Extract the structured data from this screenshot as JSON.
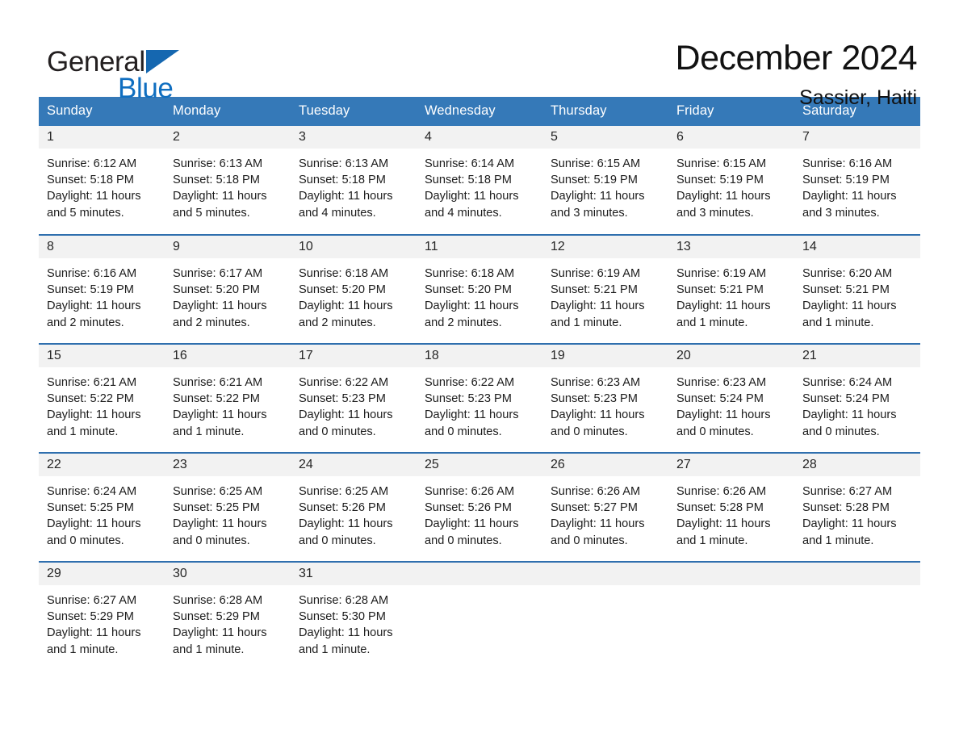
{
  "brand": {
    "word1": "General",
    "word2": "Blue",
    "flag_color": "#1567b0",
    "blue_text_color": "#0f6ec0"
  },
  "header": {
    "title": "December 2024",
    "location": "Sassier, Haiti"
  },
  "theme": {
    "header_bg": "#3579b8",
    "row_divider": "#2f6fae",
    "daynum_bg": "#f2f2f2",
    "page_bg": "#ffffff"
  },
  "calendar": {
    "weekday_headers": [
      "Sunday",
      "Monday",
      "Tuesday",
      "Wednesday",
      "Thursday",
      "Friday",
      "Saturday"
    ],
    "weeks": [
      [
        {
          "day": "1",
          "sunrise": "Sunrise: 6:12 AM",
          "sunset": "Sunset: 5:18 PM",
          "daylight1": "Daylight: 11 hours",
          "daylight2": "and 5 minutes."
        },
        {
          "day": "2",
          "sunrise": "Sunrise: 6:13 AM",
          "sunset": "Sunset: 5:18 PM",
          "daylight1": "Daylight: 11 hours",
          "daylight2": "and 5 minutes."
        },
        {
          "day": "3",
          "sunrise": "Sunrise: 6:13 AM",
          "sunset": "Sunset: 5:18 PM",
          "daylight1": "Daylight: 11 hours",
          "daylight2": "and 4 minutes."
        },
        {
          "day": "4",
          "sunrise": "Sunrise: 6:14 AM",
          "sunset": "Sunset: 5:18 PM",
          "daylight1": "Daylight: 11 hours",
          "daylight2": "and 4 minutes."
        },
        {
          "day": "5",
          "sunrise": "Sunrise: 6:15 AM",
          "sunset": "Sunset: 5:19 PM",
          "daylight1": "Daylight: 11 hours",
          "daylight2": "and 3 minutes."
        },
        {
          "day": "6",
          "sunrise": "Sunrise: 6:15 AM",
          "sunset": "Sunset: 5:19 PM",
          "daylight1": "Daylight: 11 hours",
          "daylight2": "and 3 minutes."
        },
        {
          "day": "7",
          "sunrise": "Sunrise: 6:16 AM",
          "sunset": "Sunset: 5:19 PM",
          "daylight1": "Daylight: 11 hours",
          "daylight2": "and 3 minutes."
        }
      ],
      [
        {
          "day": "8",
          "sunrise": "Sunrise: 6:16 AM",
          "sunset": "Sunset: 5:19 PM",
          "daylight1": "Daylight: 11 hours",
          "daylight2": "and 2 minutes."
        },
        {
          "day": "9",
          "sunrise": "Sunrise: 6:17 AM",
          "sunset": "Sunset: 5:20 PM",
          "daylight1": "Daylight: 11 hours",
          "daylight2": "and 2 minutes."
        },
        {
          "day": "10",
          "sunrise": "Sunrise: 6:18 AM",
          "sunset": "Sunset: 5:20 PM",
          "daylight1": "Daylight: 11 hours",
          "daylight2": "and 2 minutes."
        },
        {
          "day": "11",
          "sunrise": "Sunrise: 6:18 AM",
          "sunset": "Sunset: 5:20 PM",
          "daylight1": "Daylight: 11 hours",
          "daylight2": "and 2 minutes."
        },
        {
          "day": "12",
          "sunrise": "Sunrise: 6:19 AM",
          "sunset": "Sunset: 5:21 PM",
          "daylight1": "Daylight: 11 hours",
          "daylight2": "and 1 minute."
        },
        {
          "day": "13",
          "sunrise": "Sunrise: 6:19 AM",
          "sunset": "Sunset: 5:21 PM",
          "daylight1": "Daylight: 11 hours",
          "daylight2": "and 1 minute."
        },
        {
          "day": "14",
          "sunrise": "Sunrise: 6:20 AM",
          "sunset": "Sunset: 5:21 PM",
          "daylight1": "Daylight: 11 hours",
          "daylight2": "and 1 minute."
        }
      ],
      [
        {
          "day": "15",
          "sunrise": "Sunrise: 6:21 AM",
          "sunset": "Sunset: 5:22 PM",
          "daylight1": "Daylight: 11 hours",
          "daylight2": "and 1 minute."
        },
        {
          "day": "16",
          "sunrise": "Sunrise: 6:21 AM",
          "sunset": "Sunset: 5:22 PM",
          "daylight1": "Daylight: 11 hours",
          "daylight2": "and 1 minute."
        },
        {
          "day": "17",
          "sunrise": "Sunrise: 6:22 AM",
          "sunset": "Sunset: 5:23 PM",
          "daylight1": "Daylight: 11 hours",
          "daylight2": "and 0 minutes."
        },
        {
          "day": "18",
          "sunrise": "Sunrise: 6:22 AM",
          "sunset": "Sunset: 5:23 PM",
          "daylight1": "Daylight: 11 hours",
          "daylight2": "and 0 minutes."
        },
        {
          "day": "19",
          "sunrise": "Sunrise: 6:23 AM",
          "sunset": "Sunset: 5:23 PM",
          "daylight1": "Daylight: 11 hours",
          "daylight2": "and 0 minutes."
        },
        {
          "day": "20",
          "sunrise": "Sunrise: 6:23 AM",
          "sunset": "Sunset: 5:24 PM",
          "daylight1": "Daylight: 11 hours",
          "daylight2": "and 0 minutes."
        },
        {
          "day": "21",
          "sunrise": "Sunrise: 6:24 AM",
          "sunset": "Sunset: 5:24 PM",
          "daylight1": "Daylight: 11 hours",
          "daylight2": "and 0 minutes."
        }
      ],
      [
        {
          "day": "22",
          "sunrise": "Sunrise: 6:24 AM",
          "sunset": "Sunset: 5:25 PM",
          "daylight1": "Daylight: 11 hours",
          "daylight2": "and 0 minutes."
        },
        {
          "day": "23",
          "sunrise": "Sunrise: 6:25 AM",
          "sunset": "Sunset: 5:25 PM",
          "daylight1": "Daylight: 11 hours",
          "daylight2": "and 0 minutes."
        },
        {
          "day": "24",
          "sunrise": "Sunrise: 6:25 AM",
          "sunset": "Sunset: 5:26 PM",
          "daylight1": "Daylight: 11 hours",
          "daylight2": "and 0 minutes."
        },
        {
          "day": "25",
          "sunrise": "Sunrise: 6:26 AM",
          "sunset": "Sunset: 5:26 PM",
          "daylight1": "Daylight: 11 hours",
          "daylight2": "and 0 minutes."
        },
        {
          "day": "26",
          "sunrise": "Sunrise: 6:26 AM",
          "sunset": "Sunset: 5:27 PM",
          "daylight1": "Daylight: 11 hours",
          "daylight2": "and 0 minutes."
        },
        {
          "day": "27",
          "sunrise": "Sunrise: 6:26 AM",
          "sunset": "Sunset: 5:28 PM",
          "daylight1": "Daylight: 11 hours",
          "daylight2": "and 1 minute."
        },
        {
          "day": "28",
          "sunrise": "Sunrise: 6:27 AM",
          "sunset": "Sunset: 5:28 PM",
          "daylight1": "Daylight: 11 hours",
          "daylight2": "and 1 minute."
        }
      ],
      [
        {
          "day": "29",
          "sunrise": "Sunrise: 6:27 AM",
          "sunset": "Sunset: 5:29 PM",
          "daylight1": "Daylight: 11 hours",
          "daylight2": "and 1 minute."
        },
        {
          "day": "30",
          "sunrise": "Sunrise: 6:28 AM",
          "sunset": "Sunset: 5:29 PM",
          "daylight1": "Daylight: 11 hours",
          "daylight2": "and 1 minute."
        },
        {
          "day": "31",
          "sunrise": "Sunrise: 6:28 AM",
          "sunset": "Sunset: 5:30 PM",
          "daylight1": "Daylight: 11 hours",
          "daylight2": "and 1 minute."
        },
        {
          "day": "",
          "sunrise": "",
          "sunset": "",
          "daylight1": "",
          "daylight2": ""
        },
        {
          "day": "",
          "sunrise": "",
          "sunset": "",
          "daylight1": "",
          "daylight2": ""
        },
        {
          "day": "",
          "sunrise": "",
          "sunset": "",
          "daylight1": "",
          "daylight2": ""
        },
        {
          "day": "",
          "sunrise": "",
          "sunset": "",
          "daylight1": "",
          "daylight2": ""
        }
      ]
    ]
  }
}
